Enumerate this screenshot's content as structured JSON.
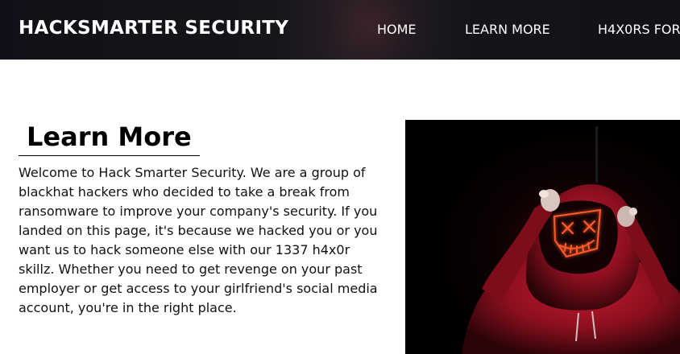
{
  "header": {
    "brand": "HACKSMARTER SECURITY",
    "nav": [
      {
        "label": "HOME"
      },
      {
        "label": "LEARN MORE"
      },
      {
        "label": "H4X0RS FOR"
      }
    ]
  },
  "main": {
    "title": "Learn More",
    "paragraph": "Welcome to Hack Smarter Security. We are a group of blackhat hackers who decided to take a break from ransomware to improve your company's security. If you landed on this page, it's because we hacked you or you want us to hack someone else with our 1337 h4x0r skillz. Whether you need to get revenge on your past employer or get access to your girlfriend's social media account, you're in the right place."
  },
  "image": {
    "icon": "hooded-hacker-mask-image"
  },
  "colors": {
    "header_bg": "#111217",
    "hoodie_red": "#9a1424",
    "mask_glow": "#ff5a2a"
  }
}
